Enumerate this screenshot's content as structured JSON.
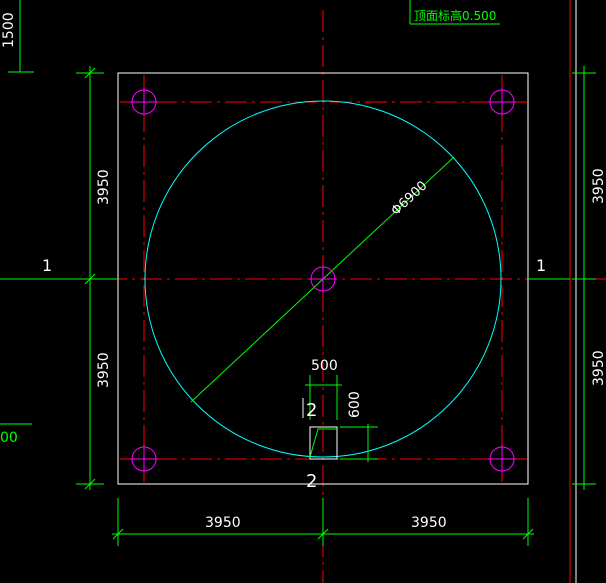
{
  "drawing": {
    "top_label": "顶面标高0.500",
    "top_left_dim": "1500",
    "left_partial_dim": "00",
    "axis_label_left": "1",
    "axis_label_right": "1",
    "dim_left_upper": "3950",
    "dim_left_lower": "3950",
    "dim_right_upper": "3950",
    "dim_right_lower": "3950",
    "dim_bottom_left": "3950",
    "dim_bottom_right": "3950",
    "circle_label": "Φ6900",
    "opening_width": "500",
    "opening_height": "600",
    "section_mark_top": "2",
    "section_mark_bottom": "2"
  },
  "colors": {
    "background": "#000000",
    "outline": "#ffffff",
    "circle": "#00ffff",
    "axis": "#ff0000",
    "pile": "#ff00ff",
    "dimension": "#00ff00"
  }
}
